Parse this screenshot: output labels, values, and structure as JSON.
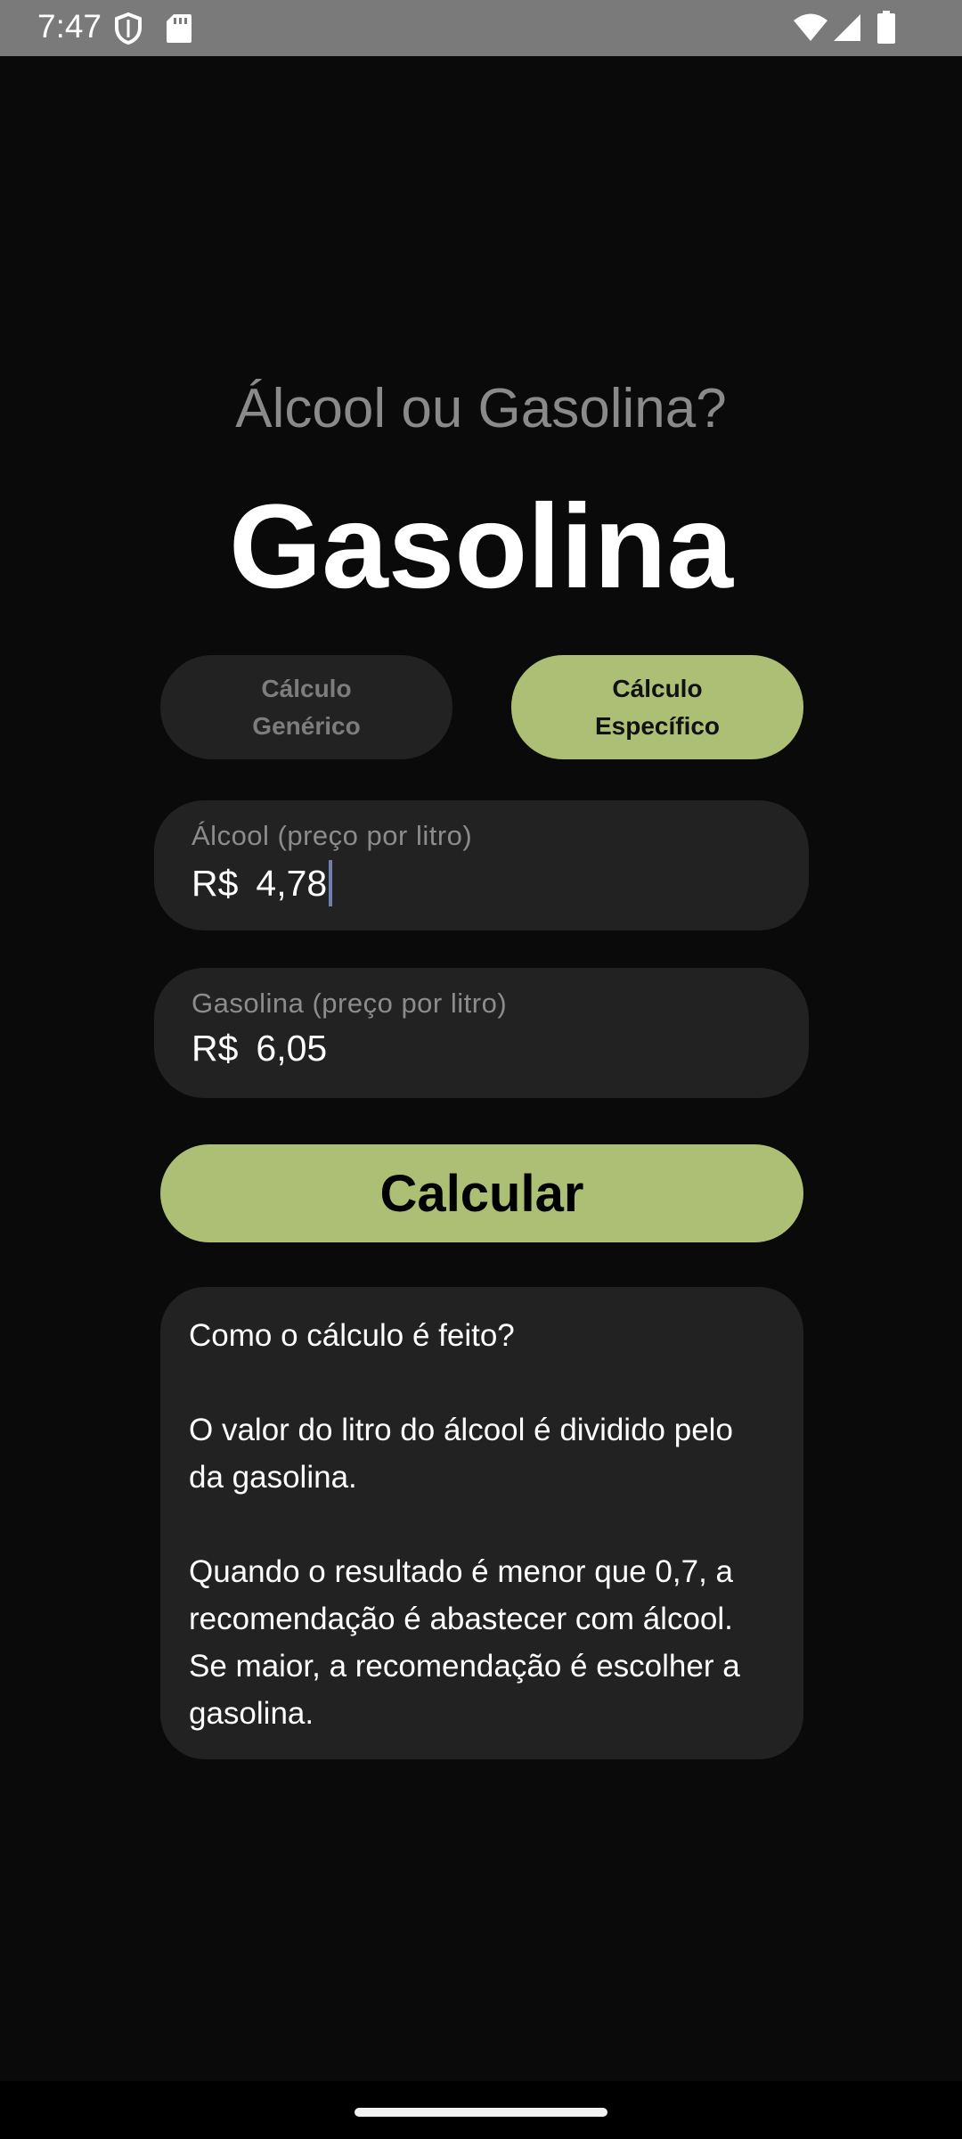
{
  "status_bar": {
    "time": "7:47",
    "left_icons": [
      "shield-icon",
      "sd-card-icon"
    ],
    "right_icons": [
      "wifi-icon",
      "signal-icon",
      "battery-icon"
    ]
  },
  "app": {
    "subtitle": "Álcool ou Gasolina?",
    "result": "Gasolina",
    "toggles": {
      "generic": "Cálculo\nGenérico",
      "specific": "Cálculo\nEspecífico",
      "selected": "specific"
    },
    "fields": {
      "alcohol": {
        "label": "Álcool (preço por litro)",
        "prefix": "R$",
        "value": "4,78"
      },
      "gasoline": {
        "label": "Gasolina (preço por litro)",
        "prefix": "R$",
        "value": "6,05"
      }
    },
    "calculate_label": "Calcular",
    "info": {
      "question": "Como o cálculo é feito?",
      "paragraph1": "O valor do litro do álcool é dividido pelo da gasolina.",
      "paragraph2": "Quando o resultado é menor que 0,7, a recomendação é abastecer com álcool. Se maior, a recomendação é escolher a gasolina."
    }
  },
  "colors": {
    "accent": "#adbf75",
    "background": "#0a0a0a",
    "surface": "#222222",
    "status_bar": "#7a7a7a"
  }
}
